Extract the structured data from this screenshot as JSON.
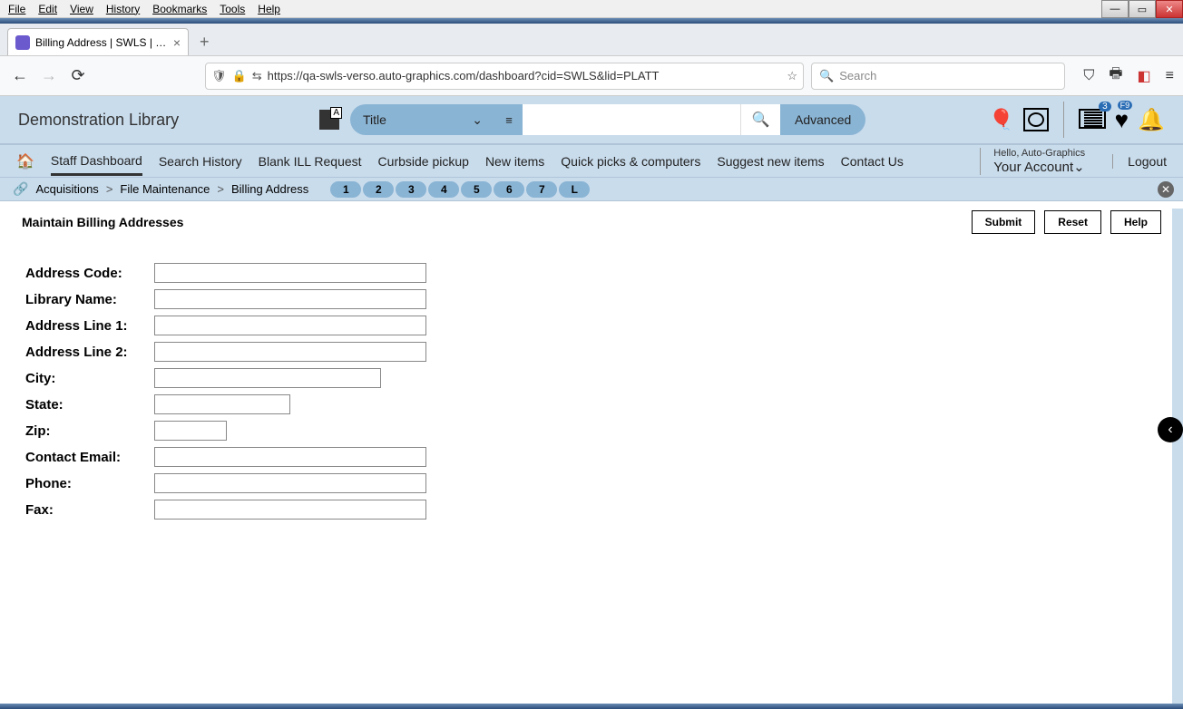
{
  "browser": {
    "menus": [
      "File",
      "Edit",
      "View",
      "History",
      "Bookmarks",
      "Tools",
      "Help"
    ],
    "tab_title": "Billing Address | SWLS | platt | A",
    "url": "https://qa-swls-verso.auto-graphics.com/dashboard?cid=SWLS&lid=PLATT",
    "search_placeholder": "Search"
  },
  "header": {
    "library_name": "Demonstration Library",
    "search_scope": "Title",
    "advanced": "Advanced",
    "list_badge": "3",
    "heart_badge": "F9"
  },
  "nav": {
    "items": [
      "Staff Dashboard",
      "Search History",
      "Blank ILL Request",
      "Curbside pickup",
      "New items",
      "Quick picks & computers",
      "Suggest new items",
      "Contact Us"
    ],
    "greeting": "Hello, Auto-Graphics",
    "account": "Your Account",
    "logout": "Logout"
  },
  "breadcrumb": {
    "parts": [
      "Acquisitions",
      "File Maintenance",
      "Billing Address"
    ],
    "pages": [
      "1",
      "2",
      "3",
      "4",
      "5",
      "6",
      "7",
      "L"
    ]
  },
  "content": {
    "title": "Maintain Billing Addresses",
    "submit": "Submit",
    "reset": "Reset",
    "help": "Help"
  },
  "form": {
    "labels": {
      "address_code": "Address Code:",
      "library_name": "Library Name:",
      "address1": "Address Line 1:",
      "address2": "Address Line 2:",
      "city": "City:",
      "state": "State:",
      "zip": "Zip:",
      "email": "Contact Email:",
      "phone": "Phone:",
      "fax": "Fax:"
    },
    "values": {
      "address_code": "",
      "library_name": "",
      "address1": "",
      "address2": "",
      "city": "",
      "state": "",
      "zip": "",
      "email": "",
      "phone": "",
      "fax": ""
    }
  }
}
